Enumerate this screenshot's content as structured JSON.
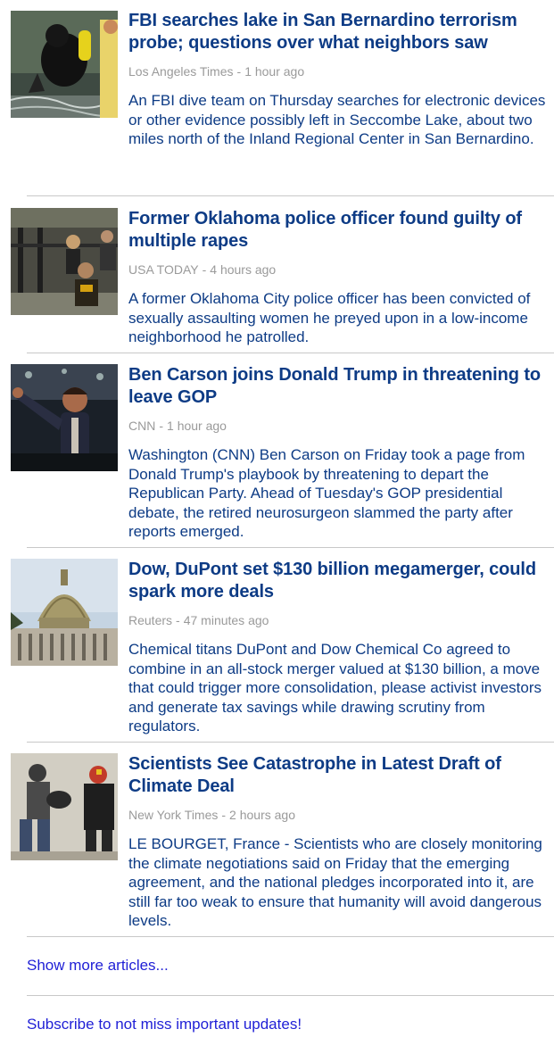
{
  "articles": [
    {
      "headline": "FBI searches lake in San Bernardino terrorism probe; questions over what neighbors saw",
      "source": "Los Angeles Times",
      "time": "1 hour ago",
      "summary": "An FBI dive team on Thursday searches for electronic devices or other evidence possibly left in Seccombe Lake, about two miles north of the Inland Regional Center in San Bernardino."
    },
    {
      "headline": "Former Oklahoma police officer found guilty of multiple rapes",
      "source": "USA TODAY",
      "time": "4 hours ago",
      "summary": "A former Oklahoma City police officer has been convicted of sexually assaulting women he preyed upon in a low-income neighborhood he patrolled."
    },
    {
      "headline": "Ben Carson joins Donald Trump in threatening to leave GOP",
      "source": "CNN",
      "time": "1 hour ago",
      "summary": "Washington (CNN) Ben Carson on Friday took a page from Donald Trump's playbook by threatening to depart the Republican Party. Ahead of Tuesday's GOP presidential debate, the retired neurosurgeon slammed the party after reports emerged."
    },
    {
      "headline": "Dow, DuPont set $130 billion megamerger, could spark more deals",
      "source": "Reuters",
      "time": "47 minutes ago",
      "summary": "Chemical titans DuPont and Dow Chemical Co agreed to combine in an all-stock merger valued at $130 billion, a move that could trigger more consolidation, please activist investors and generate tax savings while drawing scrutiny from regulators."
    },
    {
      "headline": "Scientists See Catastrophe in Latest Draft of Climate Deal",
      "source": "New York Times",
      "time": "2 hours ago",
      "summary": "LE BOURGET, France - Scientists who are closely monitoring the climate negotiations said on Friday that the emerging agreement, and the national pledges incorporated into it, are still far too weak to ensure that humanity will avoid dangerous levels."
    }
  ],
  "meta_separator": "-",
  "links": {
    "show_more": "Show more articles...",
    "subscribe": "Subscribe to not miss important updates!"
  },
  "colors": {
    "headline": "#0d3b85",
    "meta": "#9a9a9a",
    "link": "#1f1fd6",
    "divider": "#c8c8c8"
  }
}
